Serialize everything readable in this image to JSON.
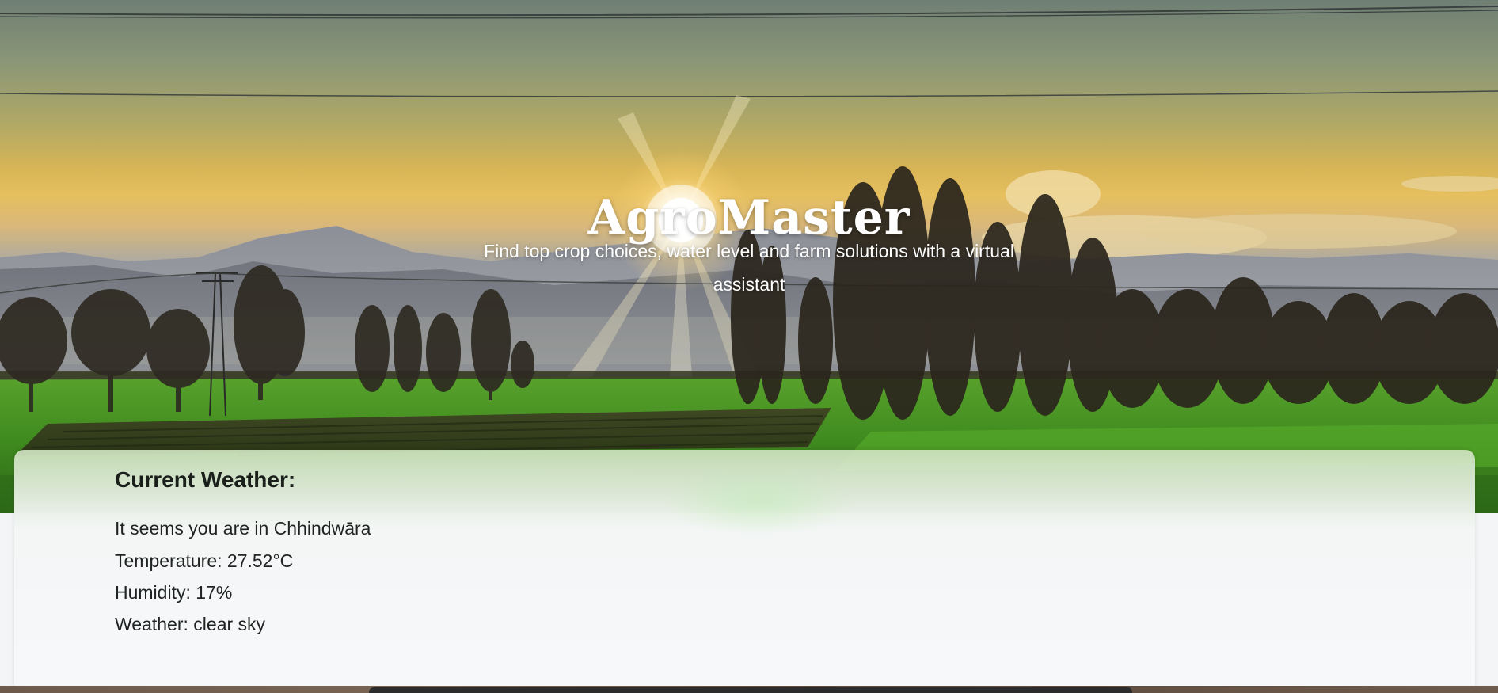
{
  "hero": {
    "title": "AgroMaster",
    "subtitle": "Find top crop choices, water level and farm solutions with a virtual assistant",
    "background_scene": "sunset-over-fields-with-mountains-and-trees"
  },
  "weather": {
    "heading": "Current Weather:",
    "location_line": "It seems you are in Chhindwāra",
    "temperature_line": "Temperature: 27.52°C",
    "humidity_line": "Humidity: 17%",
    "condition_line": "Weather: clear sky"
  },
  "colors": {
    "hero_text": "#ffffff",
    "card_bg": "#f7f8fa",
    "card_tint": "#cde2be",
    "body_text": "#1f2321"
  }
}
